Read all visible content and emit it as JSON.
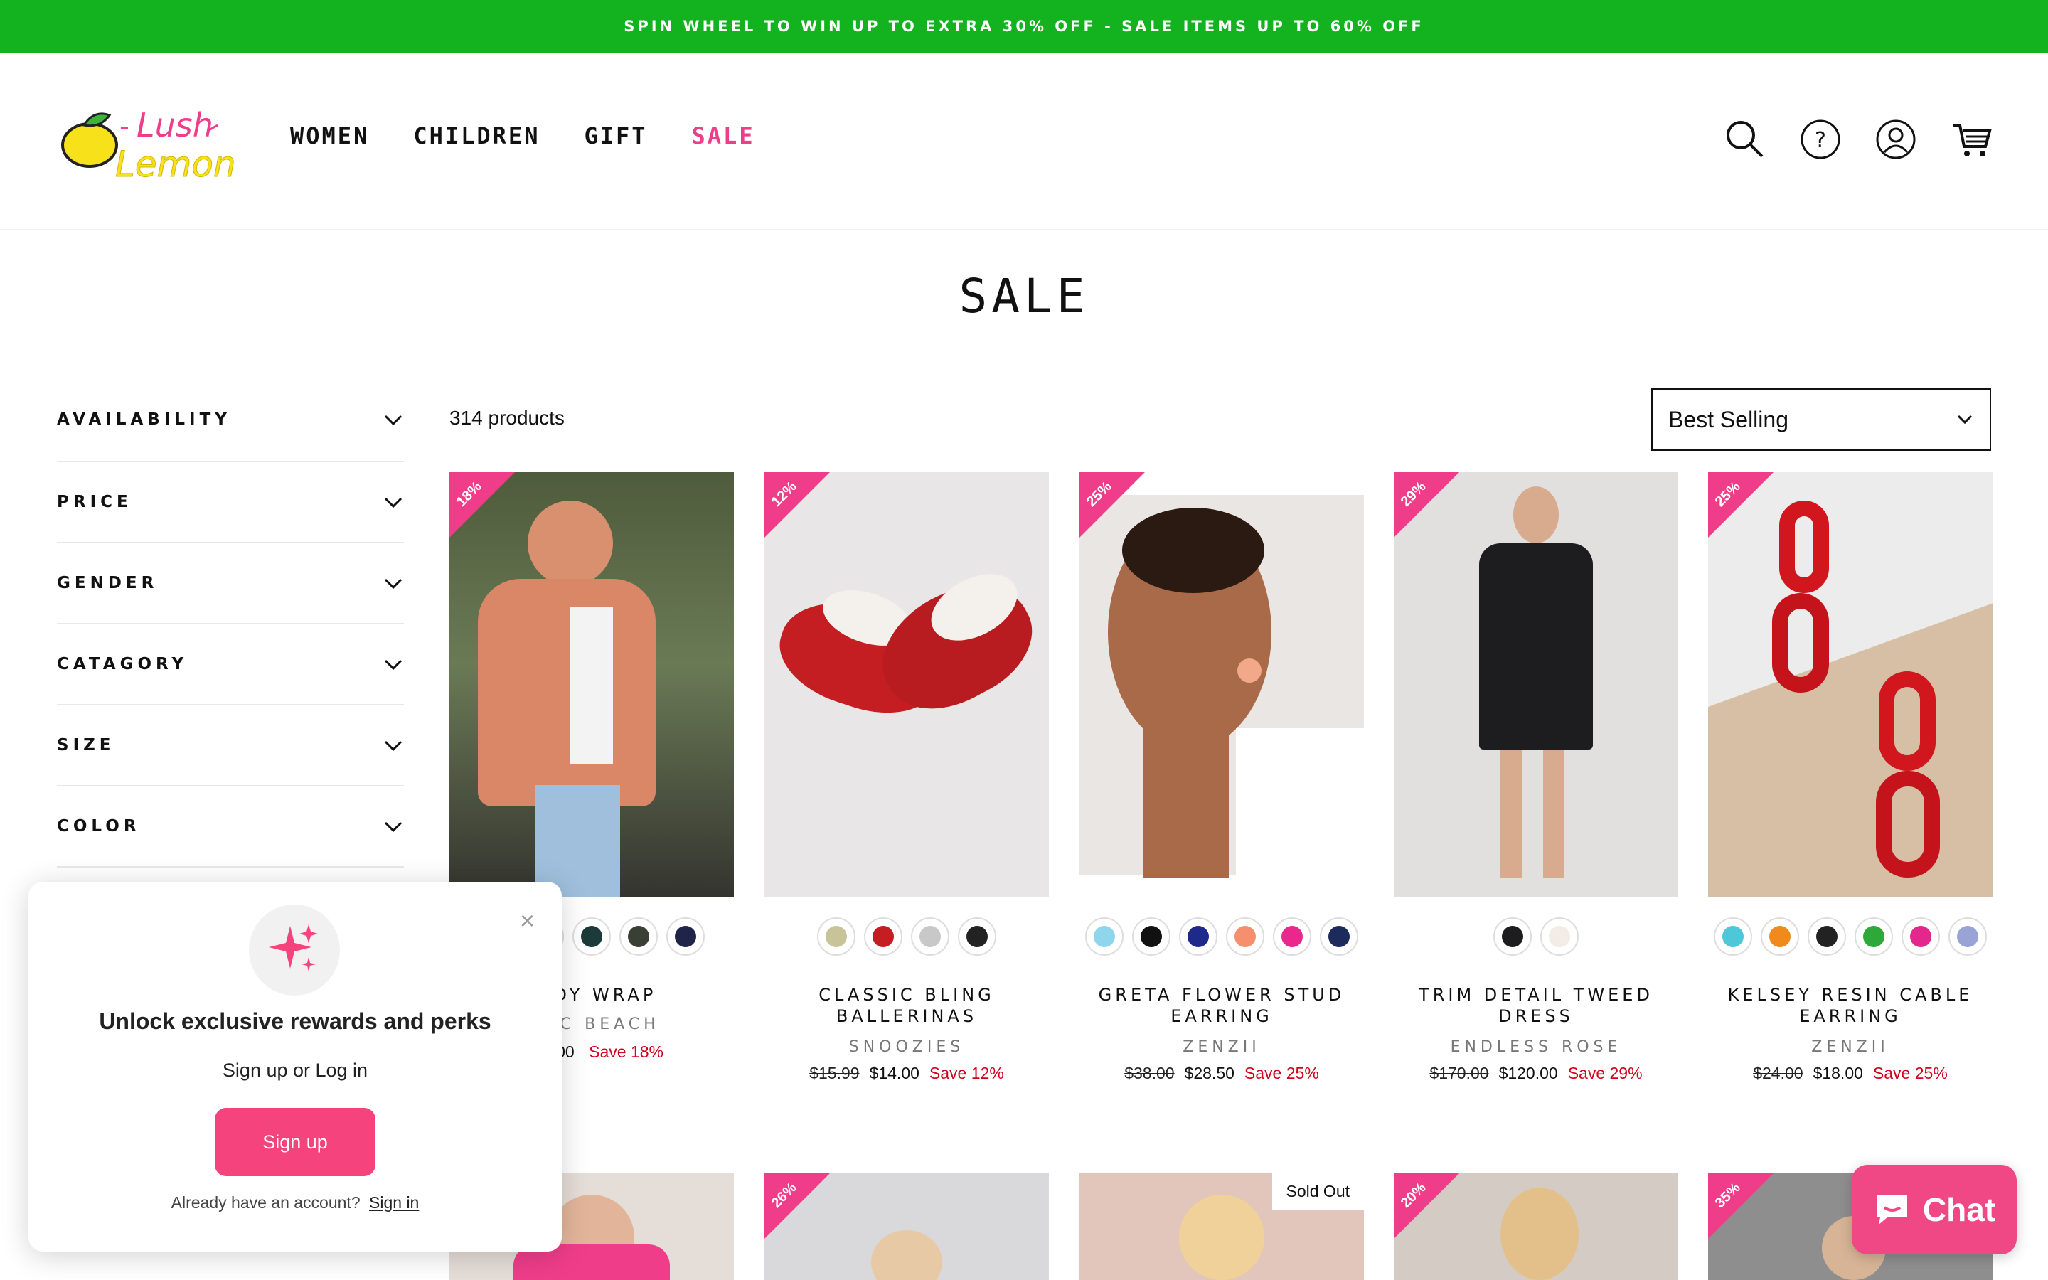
{
  "announcement": "SPIN WHEEL TO WIN UP TO EXTRA 30% OFF - SALE ITEMS UP TO 60% OFF",
  "logo": {
    "line1": "Lush",
    "line2": "Lemon"
  },
  "nav": [
    "WOMEN",
    "CHILDREN",
    "GIFT",
    "SALE"
  ],
  "header_icons": [
    "search-icon",
    "help-icon",
    "account-icon",
    "cart-icon"
  ],
  "page_title": "SALE",
  "filters": [
    "AVAILABILITY",
    "PRICE",
    "GENDER",
    "CATAGORY",
    "SIZE",
    "COLOR"
  ],
  "product_count": "314 products",
  "sort": {
    "selected": "Best Selling"
  },
  "products": [
    {
      "badge": "18%",
      "name": "...DY WRAP",
      "brand": "...IC BEACH",
      "old_price": "",
      "price": "...70.00",
      "save": "Save 18%"
    },
    {
      "badge": "12%",
      "name": "CLASSIC BLING BALLERINAS",
      "brand": "SNOOZIES",
      "old_price": "$15.99",
      "price": "$14.00",
      "save": "Save 12%"
    },
    {
      "badge": "25%",
      "name": "GRETA FLOWER STUD EARRING",
      "brand": "ZENZII",
      "old_price": "$38.00",
      "price": "$28.50",
      "save": "Save 25%"
    },
    {
      "badge": "29%",
      "name": "TRIM DETAIL TWEED DRESS",
      "brand": "ENDLESS ROSE",
      "old_price": "$170.00",
      "price": "$120.00",
      "save": "Save 29%"
    },
    {
      "badge": "25%",
      "name": "KELSEY RESIN CABLE EARRING",
      "brand": "ZENZII",
      "old_price": "$24.00",
      "price": "$18.00",
      "save": "Save 25%"
    }
  ],
  "row2_badges": [
    "",
    "26%",
    "",
    "20%",
    "35%"
  ],
  "sold_out": "Sold Out",
  "popup": {
    "heading": "Unlock exclusive rewards and perks",
    "sub": "Sign up or Log in",
    "button": "Sign up",
    "footer": "Already have an account?",
    "footer_link": "Sign in"
  },
  "chat": {
    "label": "Chat"
  },
  "colors": {
    "accent": "#ef3d8a",
    "announce_bg": "#12b31f",
    "save": "#d0021b"
  }
}
